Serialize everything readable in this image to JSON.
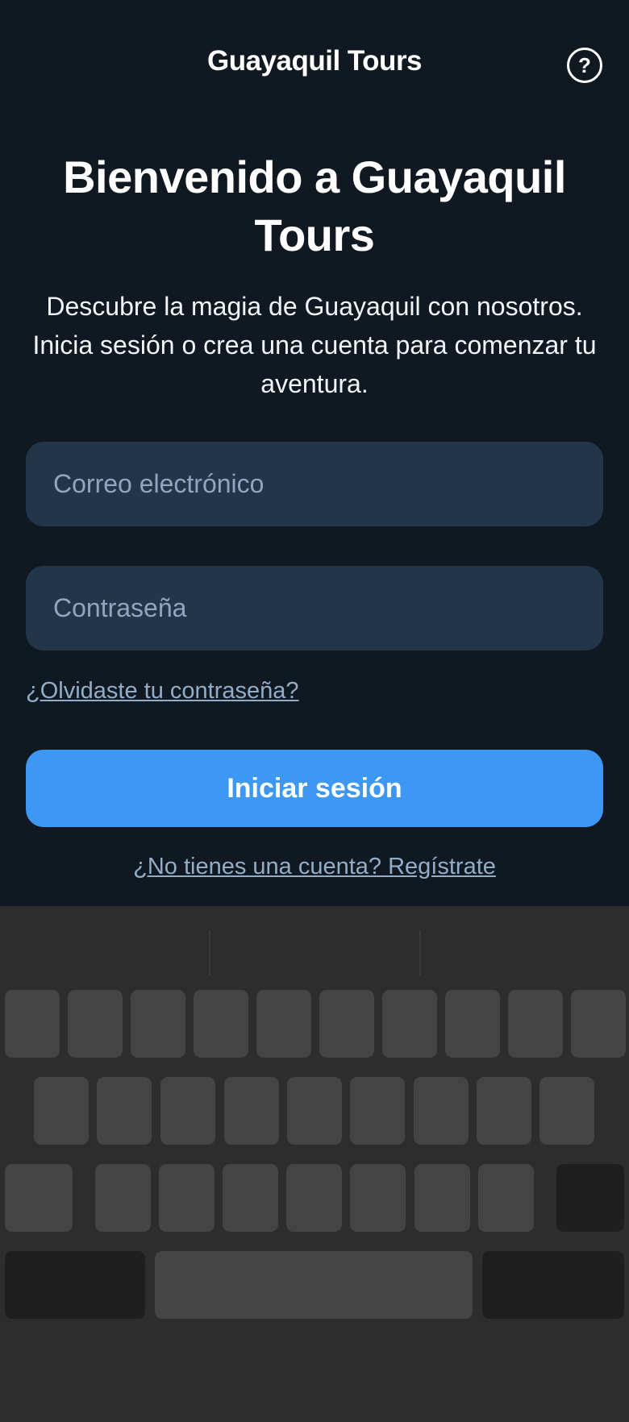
{
  "header": {
    "app_title": "Guayaquil Tours",
    "help_icon": "help-circle-icon",
    "help_glyph": "?"
  },
  "main": {
    "headline": "Bienvenido a Guayaquil Tours",
    "subtitle": "Descubre la magia de Guayaquil con nosotros. Inicia sesión o crea una cuenta para comenzar tu aventura.",
    "email_placeholder": "Correo electrónico",
    "password_placeholder": "Contraseña",
    "forgot_link": "¿Olvidaste tu contraseña?",
    "login_button": "Iniciar sesión",
    "register_link": "¿No tienes una cuenta? Regístrate"
  },
  "colors": {
    "background": "#101922",
    "input_background": "#223549",
    "accent": "#3d98f4",
    "link": "#93adc9",
    "keyboard": "#2d2d2d"
  }
}
